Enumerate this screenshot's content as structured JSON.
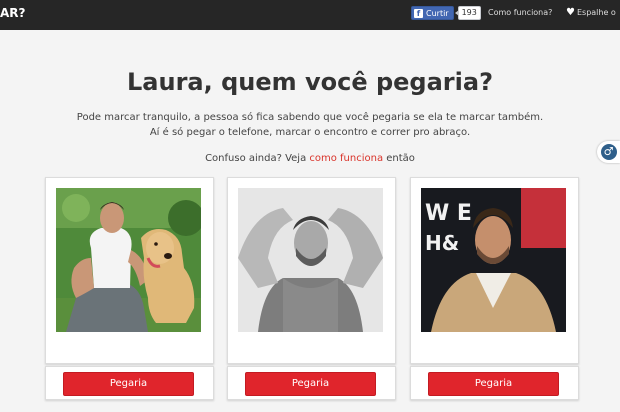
{
  "header": {
    "brand_fragment": "AR?",
    "like_label": "Curtir",
    "like_count": "193",
    "how_it_works": "Como funciona?",
    "share": "Espalhe o"
  },
  "main": {
    "title": "Laura, quem você pegaria?",
    "subtitle_line1": "Pode marcar tranquilo, a pessoa só fica sabendo que você pegaria se ela te marcar também.",
    "subtitle_line2": "Aí é só pegar o telefone, marcar o encontro e correr pro abraço.",
    "confused_prefix": "Confuso ainda? Veja ",
    "confused_link": "como funciona",
    "confused_suffix": " então"
  },
  "cards": [
    {
      "button_label": "Pegaria"
    },
    {
      "button_label": "Pegaria"
    },
    {
      "button_label": "Pegaria"
    }
  ],
  "colors": {
    "accent_red": "#e0252c",
    "link_red": "#d9342b",
    "topbar": "#262626",
    "facebook_blue": "#4267b2"
  },
  "icons": {
    "like": "facebook-icon",
    "share": "heart-icon",
    "gender": "male-symbol-icon"
  }
}
